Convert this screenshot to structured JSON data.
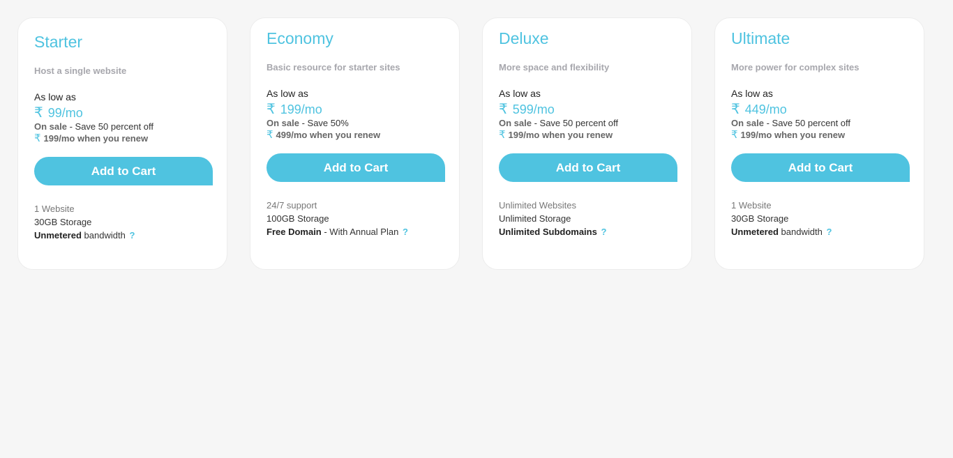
{
  "plans": [
    {
      "title": "Starter",
      "subtitle": "Host a single website",
      "as_low_as": "As low as",
      "price": "99/mo",
      "sale_label": "On sale",
      "sale_text": " - Save 50 percent off",
      "renew_text": "199/mo when you renew",
      "cta": "Add to Cart",
      "feature1": "1 Website",
      "feature2": "30GB Storage",
      "feature3_bold": "Unmetered",
      "feature3_text": " bandwidth",
      "help": "?"
    },
    {
      "title": "Economy",
      "subtitle": "Basic resource for starter sites",
      "as_low_as": "As low as",
      "price": "199/mo",
      "sale_label": "On sale",
      "sale_text": " - Save 50%",
      "renew_text": "499/mo when you renew",
      "cta": "Add to Cart",
      "feature1": "24/7 support",
      "feature2": "100GB Storage",
      "feature3_bold": "Free Domain",
      "feature3_text": " - With Annual Plan",
      "help": "?"
    },
    {
      "title": "Deluxe",
      "subtitle": "More space and flexibility",
      "as_low_as": "As low as",
      "price": "599/mo",
      "sale_label": "On sale",
      "sale_text": " - Save 50 percent off",
      "renew_text": "199/mo when you renew",
      "cta": "Add to Cart",
      "feature1": "Unlimited Websites",
      "feature2": "Unlimited Storage",
      "feature3_bold": "Unlimited Subdomains",
      "feature3_text": "",
      "help": "?"
    },
    {
      "title": "Ultimate",
      "subtitle": "More power for complex sites",
      "as_low_as": "As low as",
      "price": "449/mo",
      "sale_label": "On sale",
      "sale_text": " - Save 50 percent off",
      "renew_text": "199/mo when you renew",
      "cta": "Add to Cart",
      "feature1": "1 Website",
      "feature2": "30GB Storage",
      "feature3_bold": "Unmetered",
      "feature3_text": " bandwidth",
      "help": "?"
    }
  ],
  "currency_symbol": "₹",
  "colors": {
    "accent": "#4fc3e0",
    "background": "#f6f6f6",
    "card": "#ffffff"
  }
}
